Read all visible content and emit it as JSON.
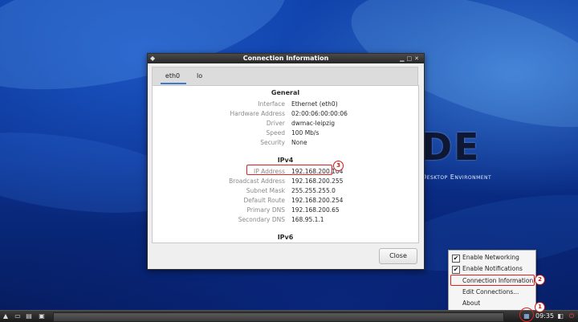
{
  "desktop": {
    "logo_big": "DE",
    "logo_sub": "Desktop Environment"
  },
  "window": {
    "title": "Connection Information",
    "tabs": [
      {
        "label": "eth0"
      },
      {
        "label": "lo"
      }
    ],
    "general": {
      "title": "General",
      "rows": [
        {
          "key": "Interface",
          "value": "Ethernet (eth0)"
        },
        {
          "key": "Hardware Address",
          "value": "02:00:06:00:00:06"
        },
        {
          "key": "Driver",
          "value": "dwmac-leipzig"
        },
        {
          "key": "Speed",
          "value": "100 Mb/s"
        },
        {
          "key": "Security",
          "value": "None"
        }
      ]
    },
    "ipv4": {
      "title": "IPv4",
      "rows": [
        {
          "key": "IP Address",
          "value": "192.168.200.104"
        },
        {
          "key": "Broadcast Address",
          "value": "192.168.200.255"
        },
        {
          "key": "Subnet Mask",
          "value": "255.255.255.0"
        },
        {
          "key": "Default Route",
          "value": "192.168.200.254"
        },
        {
          "key": "Primary DNS",
          "value": "192.168.200.65"
        },
        {
          "key": "Secondary DNS",
          "value": "168.95.1.1"
        }
      ]
    },
    "ipv6": {
      "title": "IPv6"
    },
    "close_label": "Close"
  },
  "menu": {
    "items": [
      {
        "label": "Enable Networking",
        "checked": true
      },
      {
        "label": "Enable Notifications",
        "checked": true
      },
      {
        "label": "Connection Information",
        "checked": false
      },
      {
        "label": "Edit Connections...",
        "checked": false
      },
      {
        "label": "About",
        "checked": false
      }
    ]
  },
  "annotations": {
    "badge1": "1",
    "badge2": "2",
    "badge3": "3",
    "highlight_color": "#e02020"
  },
  "taskbar": {
    "clock": "09:35",
    "icons": [
      "start-menu-icon",
      "show-desktop-icon",
      "file-manager-icon",
      "terminal-icon",
      "network-icon",
      "volume-icon",
      "power-icon"
    ]
  }
}
